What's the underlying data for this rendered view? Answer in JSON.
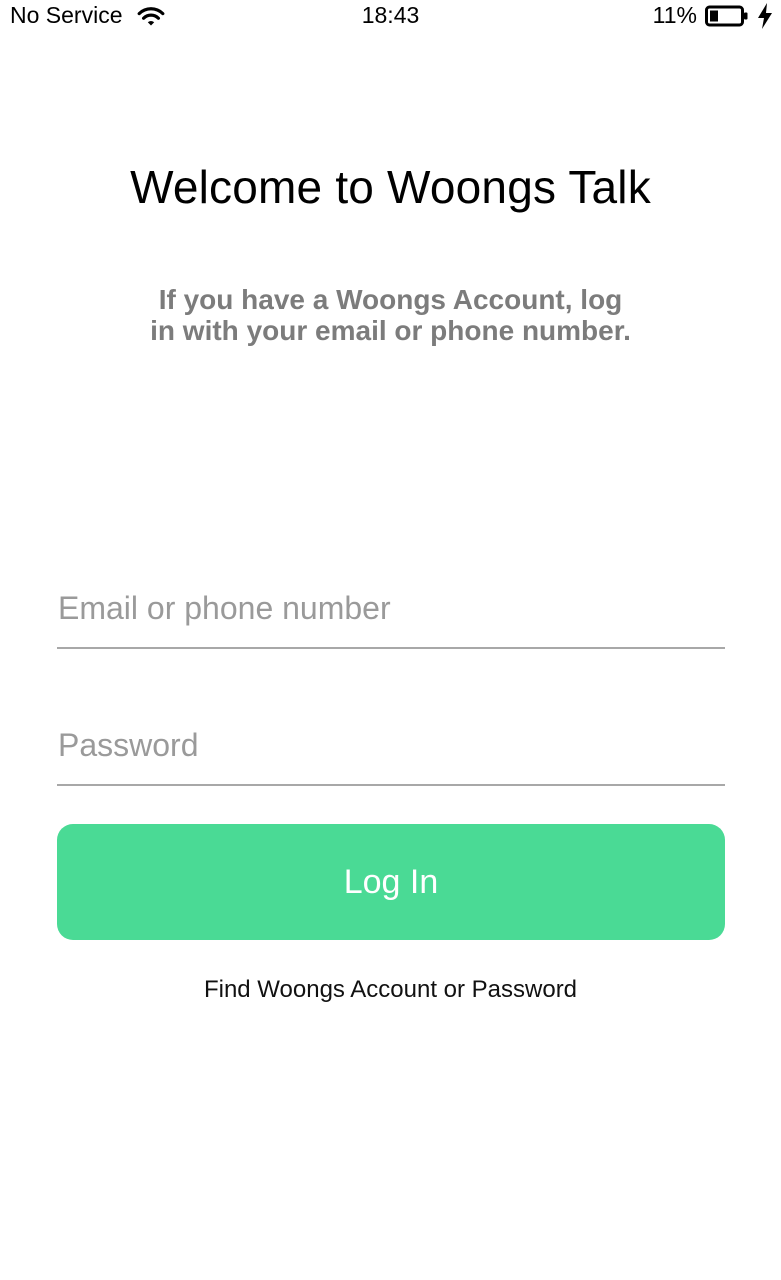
{
  "status_bar": {
    "carrier": "No Service",
    "time": "18:43",
    "battery_percent": "11%",
    "battery_level": 0.11,
    "wifi_icon": "wifi-icon",
    "battery_icon": "battery-icon",
    "charging_icon": "bolt-icon"
  },
  "login": {
    "title": "Welcome to Woongs Talk",
    "subtitle": "If you have a Woongs Account, log in with your email or phone number.",
    "email_placeholder": "Email or phone number",
    "password_placeholder": "Password",
    "login_button_label": "Log In",
    "find_account_link": "Find Woongs Account or Password"
  },
  "colors": {
    "accent": "#4ada95",
    "subtitle_text": "#7c7c7c",
    "placeholder": "#9a9a9a",
    "underline": "#a8a8a8"
  }
}
